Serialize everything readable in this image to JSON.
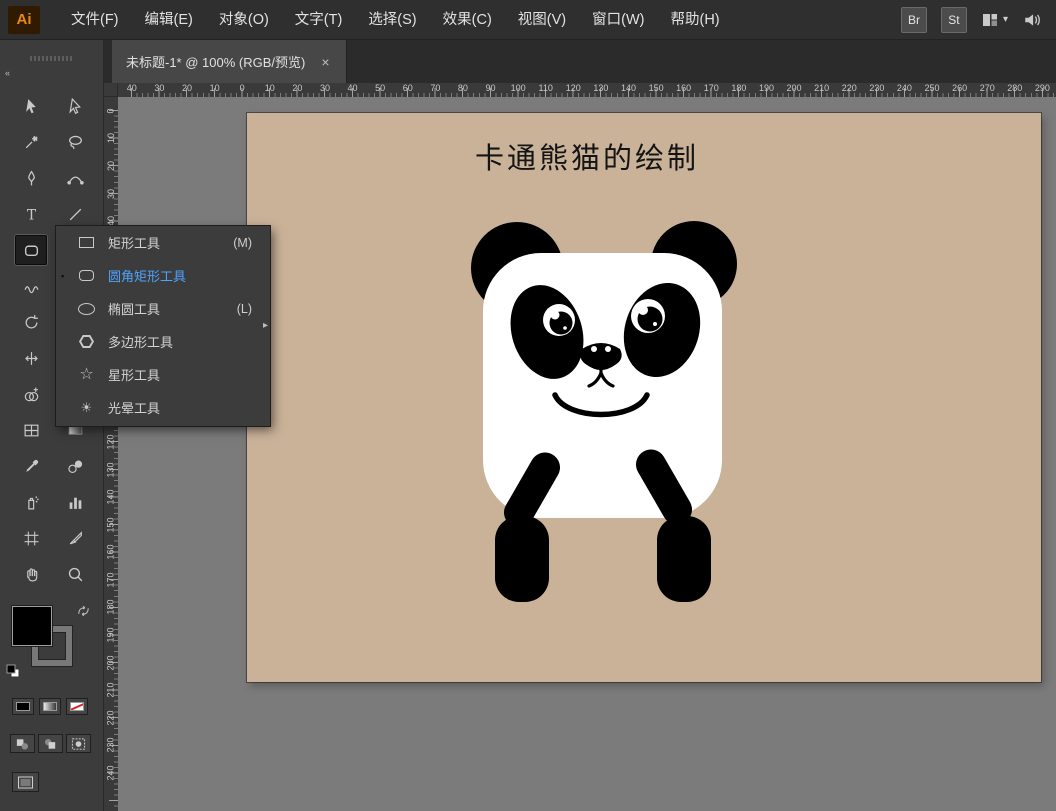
{
  "window": {
    "logo": "Ai"
  },
  "menubar": {
    "items": [
      "文件(F)",
      "编辑(E)",
      "对象(O)",
      "文字(T)",
      "选择(S)",
      "效果(C)",
      "视图(V)",
      "窗口(W)",
      "帮助(H)"
    ],
    "buttons": {
      "bridge": "Br",
      "stock": "St"
    }
  },
  "document_tab": {
    "title": "未标题-1* @ 100% (RGB/预览)",
    "close_glyph": "×"
  },
  "rulers": {
    "horizontal": [
      "40",
      "30",
      "20",
      "10",
      "0",
      "10",
      "20",
      "30",
      "40",
      "50",
      "60",
      "70",
      "80",
      "90",
      "100",
      "110",
      "120",
      "130",
      "140",
      "150",
      "160",
      "170",
      "180",
      "190",
      "200",
      "210",
      "220",
      "230",
      "240",
      "250",
      "260",
      "270",
      "280",
      "290"
    ],
    "vertical": [
      "0",
      "10",
      "20",
      "30",
      "40",
      "50",
      "60",
      "70",
      "80",
      "90",
      "100",
      "110",
      "120",
      "130",
      "140",
      "150",
      "160",
      "170",
      "180",
      "190",
      "200",
      "210",
      "220",
      "230",
      "240"
    ]
  },
  "toolbar": {
    "collapse_glyph": "«",
    "active_tool": "rounded-rectangle-tool",
    "tools": [
      "selection-tool",
      "direct-selection-tool",
      "magic-wand-tool",
      "lasso-tool",
      "pen-tool",
      "curvature-tool",
      "type-tool",
      "line-segment-tool",
      "rounded-rectangle-tool",
      "paintbrush-tool",
      "shaper-tool",
      "pencil-tool",
      "rotate-tool",
      "scale-tool",
      "width-tool",
      "free-transform-tool",
      "shape-builder-tool",
      "perspective-grid-tool",
      "mesh-tool",
      "gradient-tool",
      "eyedropper-tool",
      "blend-tool",
      "symbol-sprayer-tool",
      "column-graph-tool",
      "artboard-tool",
      "slice-tool",
      "hand-tool",
      "zoom-tool"
    ]
  },
  "tool_flyout": {
    "tearoff_glyph": "▸",
    "items": [
      {
        "type": "rect",
        "label": "矩形工具",
        "shortcut": "(M)",
        "state": ""
      },
      {
        "type": "round",
        "label": "圆角矩形工具",
        "shortcut": "",
        "state": "selected"
      },
      {
        "type": "ellipse",
        "label": "椭圆工具",
        "shortcut": "(L)",
        "state": ""
      },
      {
        "type": "polygon",
        "label": "多边形工具",
        "shortcut": "",
        "state": ""
      },
      {
        "type": "star",
        "label": "星形工具",
        "shortcut": "",
        "state": ""
      },
      {
        "type": "flare",
        "label": "光晕工具",
        "shortcut": "",
        "state": ""
      }
    ]
  },
  "canvas": {
    "artboard_title": "卡通熊猫的绘制",
    "artboard_color": "#cab299"
  },
  "colors": {
    "selection_blue": "#4da3ff",
    "panda_black": "#000000",
    "panda_white": "#ffffff"
  }
}
